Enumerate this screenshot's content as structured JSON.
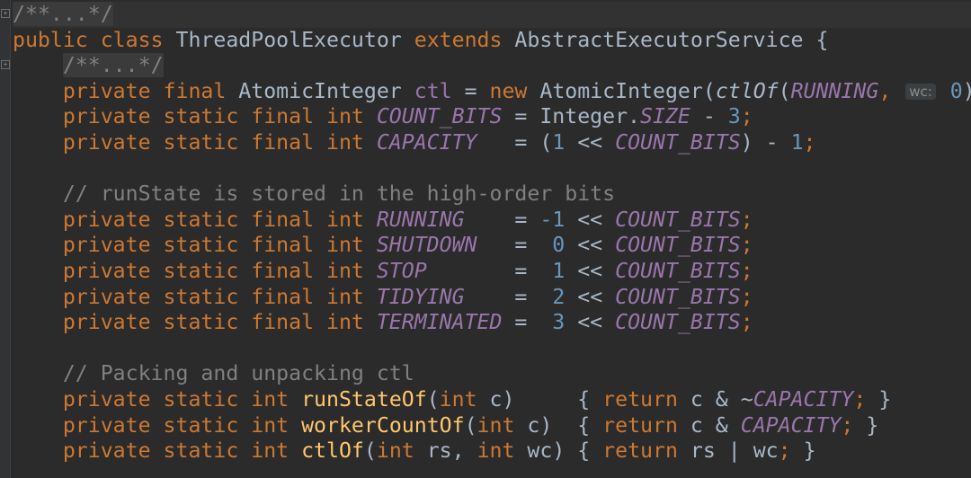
{
  "lines": [
    {
      "tokens": [
        {
          "t": "/**...*/",
          "c": "fold-text"
        }
      ]
    },
    {
      "tokens": [
        {
          "t": "public class ",
          "c": "kw"
        },
        {
          "t": "ThreadPoolExecutor ",
          "c": ""
        },
        {
          "t": "extends ",
          "c": "kw"
        },
        {
          "t": "AbstractExecutorService {",
          "c": ""
        }
      ]
    },
    {
      "tokens": [
        {
          "t": "    ",
          "c": ""
        },
        {
          "t": "/**...*/",
          "c": "fold-text"
        }
      ]
    },
    {
      "tokens": [
        {
          "t": "    private final ",
          "c": "kw"
        },
        {
          "t": "AtomicInteger ",
          "c": ""
        },
        {
          "t": "ctl",
          "c": "field"
        },
        {
          "t": " = ",
          "c": ""
        },
        {
          "t": "new ",
          "c": "kw"
        },
        {
          "t": "AtomicInteger(",
          "c": ""
        },
        {
          "t": "ctlOf",
          "c": "istat"
        },
        {
          "t": "(",
          "c": ""
        },
        {
          "t": "RUNNING",
          "c": "ifield"
        },
        {
          "t": ", ",
          "c": "kw"
        },
        {
          "t": "wc:",
          "c": "hint"
        },
        {
          "t": " 0",
          "c": "num"
        },
        {
          "t": "));",
          "c": ""
        }
      ]
    },
    {
      "tokens": [
        {
          "t": "    private static final int ",
          "c": "kw"
        },
        {
          "t": "COUNT_BITS",
          "c": "ifield"
        },
        {
          "t": " = Integer.",
          "c": ""
        },
        {
          "t": "SIZE",
          "c": "ifield"
        },
        {
          "t": " - ",
          "c": ""
        },
        {
          "t": "3",
          "c": "num"
        },
        {
          "t": ";",
          "c": "kw"
        }
      ]
    },
    {
      "tokens": [
        {
          "t": "    private static final int ",
          "c": "kw"
        },
        {
          "t": "CAPACITY",
          "c": "ifield"
        },
        {
          "t": "   = (",
          "c": ""
        },
        {
          "t": "1",
          "c": "num"
        },
        {
          "t": " << ",
          "c": ""
        },
        {
          "t": "COUNT_BITS",
          "c": "ifield"
        },
        {
          "t": ") - ",
          "c": ""
        },
        {
          "t": "1",
          "c": "num"
        },
        {
          "t": ";",
          "c": "kw"
        }
      ]
    },
    {
      "tokens": [
        {
          "t": " ",
          "c": ""
        }
      ]
    },
    {
      "tokens": [
        {
          "t": "    // runState is stored in the high-order bits",
          "c": "cm"
        }
      ]
    },
    {
      "tokens": [
        {
          "t": "    private static final int ",
          "c": "kw"
        },
        {
          "t": "RUNNING",
          "c": "ifield"
        },
        {
          "t": "    = ",
          "c": ""
        },
        {
          "t": "-1",
          "c": "num"
        },
        {
          "t": " << ",
          "c": ""
        },
        {
          "t": "COUNT_BITS",
          "c": "ifield"
        },
        {
          "t": ";",
          "c": "kw"
        }
      ]
    },
    {
      "tokens": [
        {
          "t": "    private static final int ",
          "c": "kw"
        },
        {
          "t": "SHUTDOWN",
          "c": "ifield"
        },
        {
          "t": "   =  ",
          "c": ""
        },
        {
          "t": "0",
          "c": "num"
        },
        {
          "t": " << ",
          "c": ""
        },
        {
          "t": "COUNT_BITS",
          "c": "ifield"
        },
        {
          "t": ";",
          "c": "kw"
        }
      ]
    },
    {
      "tokens": [
        {
          "t": "    private static final int ",
          "c": "kw"
        },
        {
          "t": "STOP",
          "c": "ifield"
        },
        {
          "t": "       =  ",
          "c": ""
        },
        {
          "t": "1",
          "c": "num"
        },
        {
          "t": " << ",
          "c": ""
        },
        {
          "t": "COUNT_BITS",
          "c": "ifield"
        },
        {
          "t": ";",
          "c": "kw"
        }
      ]
    },
    {
      "tokens": [
        {
          "t": "    private static final int ",
          "c": "kw"
        },
        {
          "t": "TIDYING",
          "c": "ifield"
        },
        {
          "t": "    =  ",
          "c": ""
        },
        {
          "t": "2",
          "c": "num"
        },
        {
          "t": " << ",
          "c": ""
        },
        {
          "t": "COUNT_BITS",
          "c": "ifield"
        },
        {
          "t": ";",
          "c": "kw"
        }
      ]
    },
    {
      "tokens": [
        {
          "t": "    private static final int ",
          "c": "kw"
        },
        {
          "t": "TERMINATED",
          "c": "ifield"
        },
        {
          "t": " =  ",
          "c": ""
        },
        {
          "t": "3",
          "c": "num"
        },
        {
          "t": " << ",
          "c": ""
        },
        {
          "t": "COUNT_BITS",
          "c": "ifield"
        },
        {
          "t": ";",
          "c": "kw"
        }
      ]
    },
    {
      "tokens": [
        {
          "t": " ",
          "c": ""
        }
      ]
    },
    {
      "tokens": [
        {
          "t": "    // Packing and unpacking ctl",
          "c": "cm"
        }
      ]
    },
    {
      "tokens": [
        {
          "t": "    private static int ",
          "c": "kw"
        },
        {
          "t": "runStateOf",
          "c": "fn"
        },
        {
          "t": "(",
          "c": ""
        },
        {
          "t": "int ",
          "c": "kw"
        },
        {
          "t": "c)     { ",
          "c": ""
        },
        {
          "t": "return ",
          "c": "kw"
        },
        {
          "t": "c & ~",
          "c": ""
        },
        {
          "t": "CAPACITY",
          "c": "ifield"
        },
        {
          "t": "; ",
          "c": "kw"
        },
        {
          "t": "}",
          "c": ""
        }
      ]
    },
    {
      "tokens": [
        {
          "t": "    private static int ",
          "c": "kw"
        },
        {
          "t": "workerCountOf",
          "c": "fn"
        },
        {
          "t": "(",
          "c": ""
        },
        {
          "t": "int ",
          "c": "kw"
        },
        {
          "t": "c)  { ",
          "c": ""
        },
        {
          "t": "return ",
          "c": "kw"
        },
        {
          "t": "c & ",
          "c": ""
        },
        {
          "t": "CAPACITY",
          "c": "ifield"
        },
        {
          "t": "; ",
          "c": "kw"
        },
        {
          "t": "}",
          "c": ""
        }
      ]
    },
    {
      "tokens": [
        {
          "t": "    private static int ",
          "c": "kw"
        },
        {
          "t": "ctlOf",
          "c": "fn"
        },
        {
          "t": "(",
          "c": ""
        },
        {
          "t": "int ",
          "c": "kw"
        },
        {
          "t": "rs, ",
          "c": ""
        },
        {
          "t": "int ",
          "c": "kw"
        },
        {
          "t": "wc) { ",
          "c": ""
        },
        {
          "t": "return ",
          "c": "kw"
        },
        {
          "t": "rs | wc",
          "c": ""
        },
        {
          "t": "; ",
          "c": "kw"
        },
        {
          "t": "}",
          "c": ""
        }
      ]
    }
  ],
  "colors": {
    "background": "#2b2b2b",
    "keyword": "#cc7832",
    "comment": "#808080",
    "field": "#9876aa",
    "number": "#6897bb",
    "method": "#ffc66d",
    "text": "#a9b7c6"
  }
}
